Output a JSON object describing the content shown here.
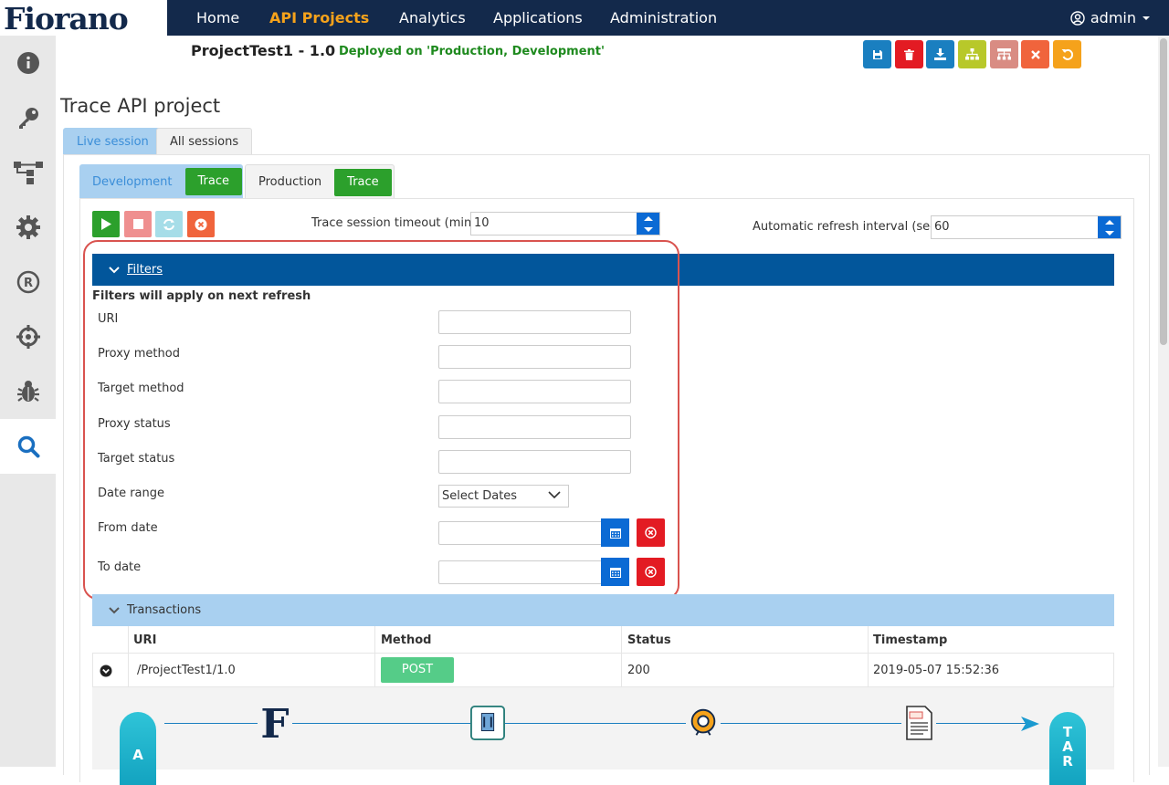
{
  "app": {
    "logo_text": "Fiorano"
  },
  "nav": {
    "items": [
      {
        "label": "Home",
        "active": false
      },
      {
        "label": "API Projects",
        "active": true
      },
      {
        "label": "Analytics",
        "active": false
      },
      {
        "label": "Applications",
        "active": false
      },
      {
        "label": "Administration",
        "active": false
      }
    ],
    "user": "admin"
  },
  "sidebar": {
    "items": [
      {
        "icon": "info-icon"
      },
      {
        "icon": "key-icon"
      },
      {
        "icon": "flow-icon"
      },
      {
        "icon": "settings-icon"
      },
      {
        "icon": "registered-icon"
      },
      {
        "icon": "target-icon"
      },
      {
        "icon": "bug-icon"
      },
      {
        "icon": "search-icon",
        "active": true
      }
    ]
  },
  "project": {
    "title": "ProjectTest1 - 1.0",
    "deployed": "Deployed on 'Production, Development'"
  },
  "toolbar": {
    "buttons": [
      {
        "icon": "save-icon",
        "color": "#1a7fc0"
      },
      {
        "icon": "delete-icon",
        "color": "#e31b23"
      },
      {
        "icon": "download-icon",
        "color": "#1a7fc0"
      },
      {
        "icon": "hierarchy-icon",
        "color": "#b8c82a"
      },
      {
        "icon": "structure-icon",
        "color": "#d98c83"
      },
      {
        "icon": "close-icon",
        "color": "#f0643c"
      },
      {
        "icon": "undo-icon",
        "color": "#f5a21b"
      }
    ]
  },
  "page": {
    "title": "Trace API project"
  },
  "tabs": {
    "live": "Live session",
    "all": "All sessions"
  },
  "env": {
    "dev_label": "Development",
    "prod_label": "Production",
    "trace_label": "Trace"
  },
  "controls": {
    "timeout_label": "Trace session timeout (mins)",
    "timeout_value": "10",
    "refresh_label": "Automatic refresh interval (secs)",
    "refresh_value": "60"
  },
  "filters": {
    "header": "Filters",
    "note": "Filters will apply on next refresh",
    "fields": {
      "uri": "URI",
      "proxy_method": "Proxy method",
      "target_method": "Target method",
      "proxy_status": "Proxy status",
      "target_status": "Target status",
      "date_range": "Date range",
      "from_date": "From date",
      "to_date": "To date"
    },
    "date_range_value": "Select Dates"
  },
  "transactions": {
    "header": "Transactions",
    "columns": [
      "URI",
      "Method",
      "Status",
      "Timestamp"
    ],
    "rows": [
      {
        "uri": "/ProjectTest1/1.0",
        "method": "POST",
        "status": "200",
        "timestamp": "2019-05-07 15:52:36"
      }
    ]
  },
  "flow": {
    "left_label": "A\nP",
    "right_label": "T\nAR"
  },
  "colors": {
    "nav_bg": "#13294b",
    "accent": "#f5a21b",
    "primary": "#0b6ad4",
    "success": "#2ca02c",
    "danger": "#e31b23"
  }
}
